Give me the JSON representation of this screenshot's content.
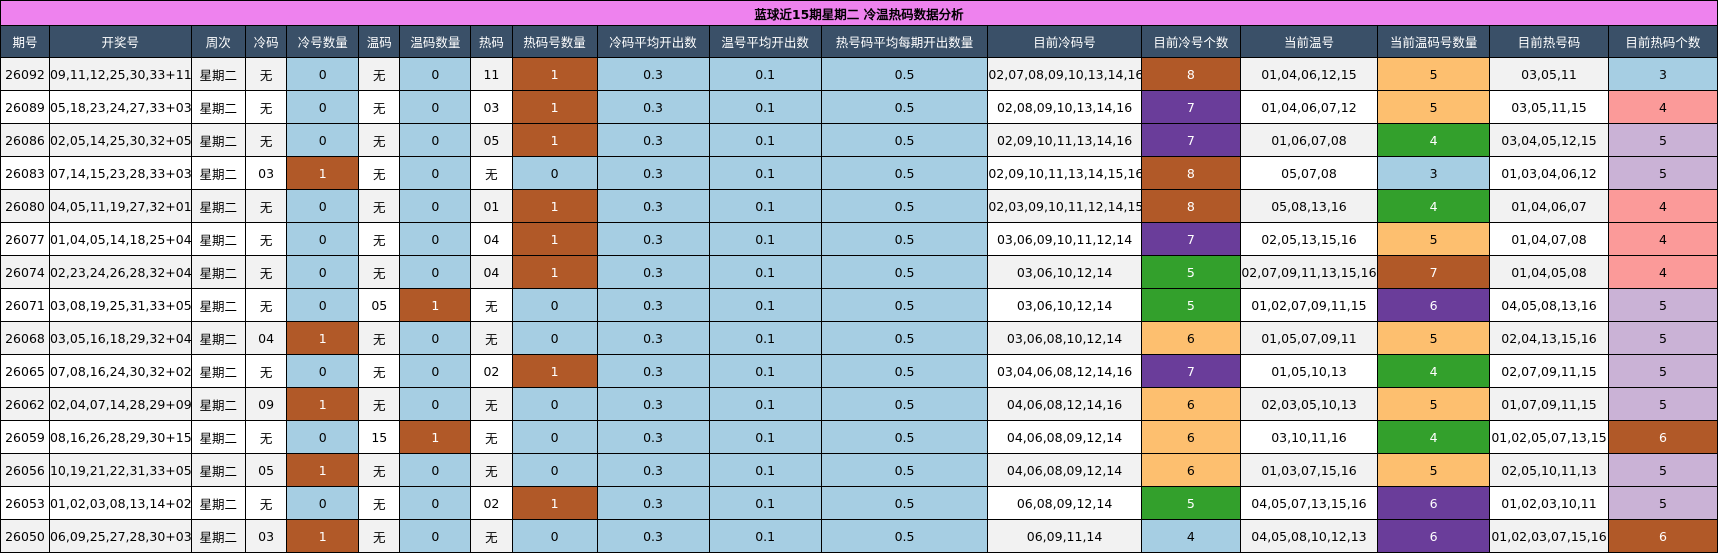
{
  "title": "蓝球近15期星期二 冷温热码数据分析",
  "headers": [
    "期号",
    "开奖号",
    "周次",
    "冷码",
    "冷号数量",
    "温码",
    "温码数量",
    "热码",
    "热码号数量",
    "冷码平均开出数",
    "温号平均开出数",
    "热号码平均每期开出数量",
    "目前冷码号",
    "目前冷号个数",
    "当前温号",
    "当前温码号数量",
    "目前热号码",
    "目前热码个数"
  ],
  "colors": {
    "header_bg": "#3a5068",
    "title_bg": "#ee82ee",
    "light_blue": "#a6cee3",
    "row_alt": "#f2f2f2",
    "row_white": "#ffffff",
    "brown": "#b15928",
    "purple": "#6a3d9a",
    "green": "#33a02c",
    "orange": "#fdbf6f",
    "pink": "#fb9a99",
    "lavender": "#cab2d6"
  },
  "rows": [
    [
      "26092",
      "09,11,12,25,30,33+11",
      "星期二",
      "无",
      "0",
      "无",
      "0",
      "11",
      "1",
      "0.3",
      "0.1",
      "0.5",
      "02,07,08,09,10,13,14,16",
      "8",
      "01,04,06,12,15",
      "5",
      "03,05,11",
      "3"
    ],
    [
      "26089",
      "05,18,23,24,27,33+03",
      "星期二",
      "无",
      "0",
      "无",
      "0",
      "03",
      "1",
      "0.3",
      "0.1",
      "0.5",
      "02,08,09,10,13,14,16",
      "7",
      "01,04,06,07,12",
      "5",
      "03,05,11,15",
      "4"
    ],
    [
      "26086",
      "02,05,14,25,30,32+05",
      "星期二",
      "无",
      "0",
      "无",
      "0",
      "05",
      "1",
      "0.3",
      "0.1",
      "0.5",
      "02,09,10,11,13,14,16",
      "7",
      "01,06,07,08",
      "4",
      "03,04,05,12,15",
      "5"
    ],
    [
      "26083",
      "07,14,15,23,28,33+03",
      "星期二",
      "03",
      "1",
      "无",
      "0",
      "无",
      "0",
      "0.3",
      "0.1",
      "0.5",
      "02,09,10,11,13,14,15,16",
      "8",
      "05,07,08",
      "3",
      "01,03,04,06,12",
      "5"
    ],
    [
      "26080",
      "04,05,11,19,27,32+01",
      "星期二",
      "无",
      "0",
      "无",
      "0",
      "01",
      "1",
      "0.3",
      "0.1",
      "0.5",
      "02,03,09,10,11,12,14,15",
      "8",
      "05,08,13,16",
      "4",
      "01,04,06,07",
      "4"
    ],
    [
      "26077",
      "01,04,05,14,18,25+04",
      "星期二",
      "无",
      "0",
      "无",
      "0",
      "04",
      "1",
      "0.3",
      "0.1",
      "0.5",
      "03,06,09,10,11,12,14",
      "7",
      "02,05,13,15,16",
      "5",
      "01,04,07,08",
      "4"
    ],
    [
      "26074",
      "02,23,24,26,28,32+04",
      "星期二",
      "无",
      "0",
      "无",
      "0",
      "04",
      "1",
      "0.3",
      "0.1",
      "0.5",
      "03,06,10,12,14",
      "5",
      "02,07,09,11,13,15,16",
      "7",
      "01,04,05,08",
      "4"
    ],
    [
      "26071",
      "03,08,19,25,31,33+05",
      "星期二",
      "无",
      "0",
      "05",
      "1",
      "无",
      "0",
      "0.3",
      "0.1",
      "0.5",
      "03,06,10,12,14",
      "5",
      "01,02,07,09,11,15",
      "6",
      "04,05,08,13,16",
      "5"
    ],
    [
      "26068",
      "03,05,16,18,29,32+04",
      "星期二",
      "04",
      "1",
      "无",
      "0",
      "无",
      "0",
      "0.3",
      "0.1",
      "0.5",
      "03,06,08,10,12,14",
      "6",
      "01,05,07,09,11",
      "5",
      "02,04,13,15,16",
      "5"
    ],
    [
      "26065",
      "07,08,16,24,30,32+02",
      "星期二",
      "无",
      "0",
      "无",
      "0",
      "02",
      "1",
      "0.3",
      "0.1",
      "0.5",
      "03,04,06,08,12,14,16",
      "7",
      "01,05,10,13",
      "4",
      "02,07,09,11,15",
      "5"
    ],
    [
      "26062",
      "02,04,07,14,28,29+09",
      "星期二",
      "09",
      "1",
      "无",
      "0",
      "无",
      "0",
      "0.3",
      "0.1",
      "0.5",
      "04,06,08,12,14,16",
      "6",
      "02,03,05,10,13",
      "5",
      "01,07,09,11,15",
      "5"
    ],
    [
      "26059",
      "08,16,26,28,29,30+15",
      "星期二",
      "无",
      "0",
      "15",
      "1",
      "无",
      "0",
      "0.3",
      "0.1",
      "0.5",
      "04,06,08,09,12,14",
      "6",
      "03,10,11,16",
      "4",
      "01,02,05,07,13,15",
      "6"
    ],
    [
      "26056",
      "10,19,21,22,31,33+05",
      "星期二",
      "05",
      "1",
      "无",
      "0",
      "无",
      "0",
      "0.3",
      "0.1",
      "0.5",
      "04,06,08,09,12,14",
      "6",
      "01,03,07,15,16",
      "5",
      "02,05,10,11,13",
      "5"
    ],
    [
      "26053",
      "01,02,03,08,13,14+02",
      "星期二",
      "无",
      "0",
      "无",
      "0",
      "02",
      "1",
      "0.3",
      "0.1",
      "0.5",
      "06,08,09,12,14",
      "5",
      "04,05,07,13,15,16",
      "6",
      "01,02,03,10,11",
      "5"
    ],
    [
      "26050",
      "06,09,25,27,28,30+03",
      "星期二",
      "03",
      "1",
      "无",
      "0",
      "无",
      "0",
      "0.3",
      "0.1",
      "0.5",
      "06,09,11,14",
      "4",
      "04,05,08,10,12,13",
      "6",
      "01,02,03,07,15,16",
      "6"
    ]
  ]
}
